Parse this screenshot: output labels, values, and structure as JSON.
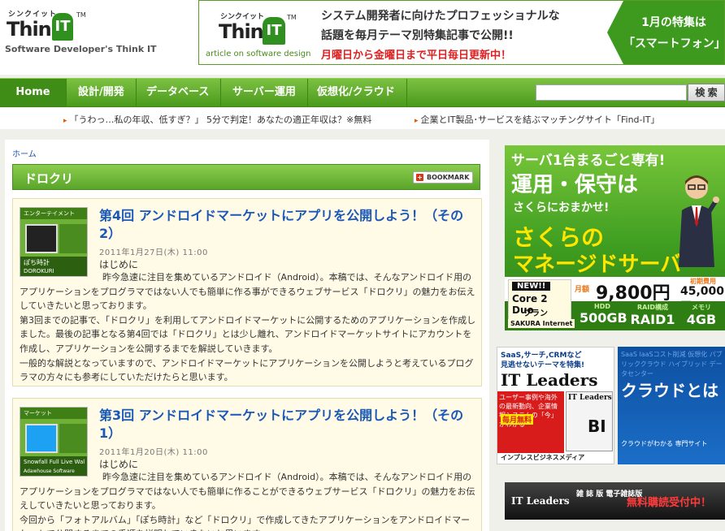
{
  "header": {
    "logo_small": "シンクイット",
    "logo_main": "Think",
    "logo_badge": "IT",
    "logo_tm": "TM",
    "tagline": "Software Developer's Think IT"
  },
  "top_banner": {
    "logo_small": "シンクイット",
    "logo_main": "Think",
    "logo_badge": "IT",
    "logo_tm": "TM",
    "sub": "article on software design",
    "line1": "システム開発者に向けたプロフェッショナルな",
    "line2": "話題を毎月テーマ別特集記事で公開!!",
    "line3": "月曜日から金曜日まで平日毎日更新中！",
    "right_line1": "1月の特集は",
    "right_line2": "「スマートフォン」"
  },
  "nav": {
    "items": [
      {
        "label": "Home"
      },
      {
        "label": "設計/開発"
      },
      {
        "label": "データベース"
      },
      {
        "label": "サーバー運用"
      },
      {
        "label": "仮想化/クラウド"
      }
    ],
    "search_value": "",
    "search_button": "検 索"
  },
  "ticker": [
    {
      "text": "「うわっ…私の年収、低すぎ？」 5分で判定！あなたの適正年収は？※無料"
    },
    {
      "text": "企業とIT製品･サービスを結ぶマッチングサイト「Find-IT」"
    }
  ],
  "main": {
    "breadcrumb": "ホーム",
    "section_title": "ドロクリ",
    "bookmark_label": "BOOKMARK",
    "articles": [
      {
        "thumb_top": "エンターテイメント",
        "thumb_bottom_1": "ぽち時計",
        "thumb_bottom_2": "DOROKURI",
        "title": "第4回 アンドロイドマーケットにアプリを公開しよう！（その2）",
        "date": "2011年1月27日(木) 11:00",
        "lead": "はじめに",
        "body": [
          "昨今急速に注目を集めているアンドロイド（Android）。本稿では、そんなアンドロイド用のアプリケーションをプログラマではない人でも簡単に作る事ができるウェブサービス「ドロクリ」の魅力をお伝えしていきたいと思っております。",
          "第3回までの記事で、「ドロクリ」を利用してアンドロイドマーケットに公開するためのアプリケーションを作成しました。最後の記事となる第4回では「ドロクリ」とは少し離れ、アンドロイドマーケットサイトにアカウントを作成し、アプリケーションを公開するまでを解説していきます。",
          "一般的な解説となっていますので、アンドロイドマーケットにアプリケーションを公開しようと考えているプログラマの方々にも参考にしていただけたらと思います。"
        ]
      },
      {
        "thumb_top": "マーケット",
        "thumb_bottom_1": "Snowfall Full Live Wal",
        "thumb_bottom_2": "Adawhouse Software",
        "title": "第3回 アンドロイドマーケットにアプリを公開しよう！（その1）",
        "date": "2011年1月20日(木) 11:00",
        "lead": "はじめに",
        "body": [
          "昨今急速に注目を集めているアンドロイド（Android）。本稿では、そんなアンドロイド用のアプリケーションをプログラマではない人でも簡単に作ることができるウェブサービス「ドロクリ」の魅力をお伝えしていきたいと思っております。",
          "今回から「フォトアルバム」「ぽち時計」など「ドロクリ」で作成してきたアプリケーションをアンドロイドマーケットで公開するまでの手順を説明していきたいと思います。"
        ]
      }
    ]
  },
  "ads": {
    "sakura": {
      "line1": "サーバ1台まるごと専有!",
      "line2": "運用・保守は",
      "line3": "さくらにおまかせ!",
      "line4": "さくらの",
      "line5": "マネージドサーバ",
      "new_label": "NEW!!",
      "cpu": "Core 2 Duo",
      "plan": "プラン",
      "monthly_label": "月額",
      "monthly_price": "9,800円",
      "initial_label": "初期費用",
      "initial_price": "45,000円",
      "specs": [
        {
          "key": "HDD",
          "value": "500GB"
        },
        {
          "key": "RAID構成",
          "value": "RAID1"
        },
        {
          "key": "メモリ",
          "value": "4GB"
        }
      ],
      "brand": "SAKURA Internet"
    },
    "itleaders": {
      "line1": "SaaS,サーチ,CRMなど",
      "line2": "見逃せないテーマを特集!",
      "title": "IT Leaders",
      "panel": "ユーザー事例や海外の最新動向、企業情報システムの「今」がわかる",
      "free": "毎月無料",
      "mag_title": "IT Leaders",
      "mag_bi": "BI",
      "footer": "インプレスビジネスメディア"
    },
    "cloud": {
      "bg_text": "SaaS laaSコスト削減 仮想化 パブリッククラウド ハイブリッド データセンター",
      "title": "クラウドとは",
      "caption": "クラウドがわかる 専門サイト"
    },
    "itl_bar": {
      "brand": "IT Leaders",
      "type": "雑 誌 版 電子雑誌版",
      "cta": "無料購読受付中！"
    }
  }
}
